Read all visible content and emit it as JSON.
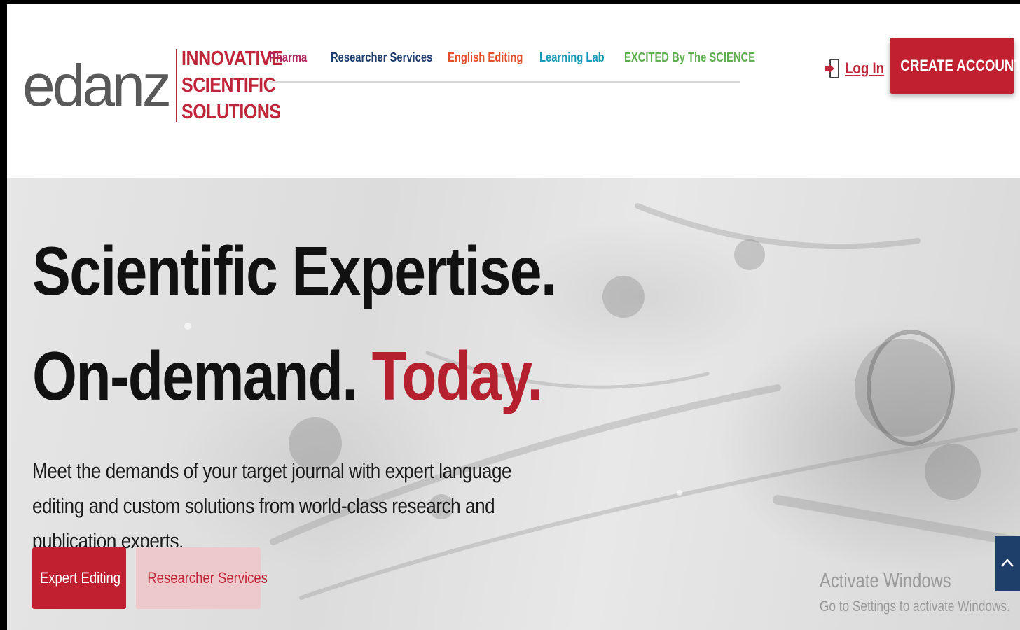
{
  "logo": {
    "wordmark": "edanz",
    "tagline": [
      "INNOVATIVE",
      "SCIENTIFIC",
      "SOLUTIONS"
    ]
  },
  "nav": {
    "items": [
      {
        "label": "Pharma",
        "color": "#b0265f"
      },
      {
        "label": "Researcher Services",
        "color": "#1e3d6b"
      },
      {
        "label": "English Editing",
        "color": "#e2512a"
      },
      {
        "label": "Learning Lab",
        "color": "#1a9bb5"
      },
      {
        "label": "EXCITED By The SCIENCE",
        "color": "#5fae4f"
      }
    ]
  },
  "header": {
    "login_label": "Log In",
    "create_account_label": "CREATE ACCOUNT"
  },
  "hero": {
    "headline_line1": "Scientific Expertise.",
    "headline_line2_a": "On-demand. ",
    "headline_line2_b": "Today.",
    "description": "Meet the demands of your target journal with expert language editing and custom solutions from world-class research and publication experts.",
    "cta_primary": "Expert Editing",
    "cta_secondary": "Researcher Services"
  },
  "watermark": {
    "title": "Activate Windows",
    "subtitle": "Go to Settings to activate Windows."
  },
  "colors": {
    "brand_red": "#c0202f",
    "brand_gray": "#595959",
    "scroll_button": "#1f3f6b"
  }
}
